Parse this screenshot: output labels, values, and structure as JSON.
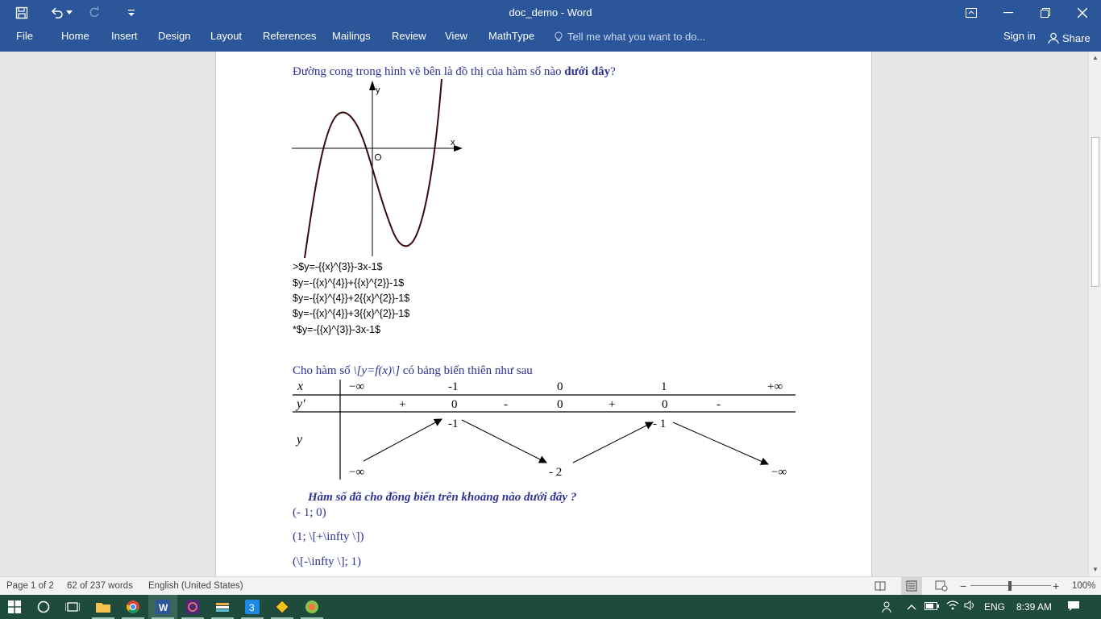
{
  "window": {
    "title": "doc_demo - Word"
  },
  "ribbon": {
    "tabs": [
      "File",
      "Home",
      "Insert",
      "Design",
      "Layout",
      "References",
      "Mailings",
      "Review",
      "View",
      "MathType"
    ],
    "tell_me": "Tell me what you want to do...",
    "sign_in": "Sign in",
    "share": "Share"
  },
  "document": {
    "q1": {
      "text_a": "Đường cong trong hình vẽ bên là đồ thị của hàm số nào ",
      "text_b": "dưới đây",
      "text_c": "?",
      "graph_labels": {
        "y": "y",
        "x": "x",
        "origin": "O"
      },
      "answers": [
        ">$y=-{{x}^{3}}-3x-1$",
        "$y=-{{x}^{4}}+{{x}^{2}}-1$",
        "$y=-{{x}^{4}}+2{{x}^{2}}-1$",
        "$y=-{{x}^{4}}+3{{x}^{2}}-1$",
        "*$y=-{{x}^{3}}-3x-1$"
      ]
    },
    "q2": {
      "intro_a": "Cho hàm số ",
      "intro_b": "\\[y=f(x)\\]",
      "intro_c": " có bảng biến thiên như sau",
      "table": {
        "row_x_label": "x",
        "row_yp_label": "y'",
        "row_y_label": "y",
        "x_values": [
          "−∞",
          "-1",
          "0",
          "1",
          "+∞"
        ],
        "yp_values": [
          "+",
          "0",
          "-",
          "0",
          "+",
          "0",
          "-"
        ],
        "y_values": [
          "−∞",
          "-1",
          "- 2",
          "- 1",
          "−∞"
        ]
      },
      "question": "Hàm số đã cho đồng biến trên khoảng nào dưới đây ?",
      "answers": [
        "(- 1; 0)",
        "(1; \\[+\\infty \\])",
        "(\\[-\\infty \\]; 1)"
      ]
    }
  },
  "statusbar": {
    "page": "Page 1 of 2",
    "words": "62 of 237 words",
    "language": "English (United States)",
    "zoom": "100%"
  },
  "taskbar": {
    "language": "ENG",
    "time": "8:39 AM"
  }
}
